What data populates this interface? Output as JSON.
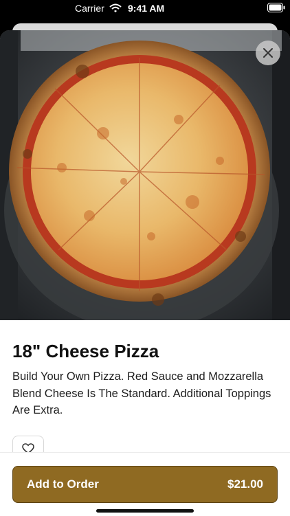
{
  "status_bar": {
    "carrier": "Carrier",
    "time": "9:41 AM"
  },
  "icons": {
    "wifi": "wifi-icon",
    "battery": "battery-icon",
    "close": "close-icon",
    "heart": "heart-icon"
  },
  "item": {
    "title": "18\" Cheese Pizza",
    "description": "Build Your Own Pizza.  Red Sauce and Mozzarella Blend Cheese Is The Standard. Additional Toppings Are Extra."
  },
  "order_button": {
    "label": "Add to Order",
    "price": "$21.00"
  },
  "colors": {
    "accent": "#8f6a22",
    "accent_border": "#5b4212"
  }
}
